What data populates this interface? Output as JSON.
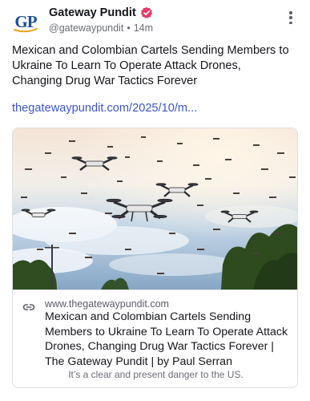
{
  "author": {
    "avatar_text": "GP",
    "name": "Gateway Pundit",
    "handle": "@gatewaypundit",
    "separator": "•",
    "time": "14m"
  },
  "post": {
    "text": "Mexican and Colombian Cartels Sending Members to Ukraine To Learn To Operate Attack Drones, Changing Drug War Tactics Forever",
    "link_text": "thegatewaypundit.com/2025/10/m..."
  },
  "card": {
    "domain": "www.thegatewaypundit.com",
    "title": "Mexican and Colombian Cartels Sending Members to Ukraine To Learn To Operate Attack Drones, Changing Drug War Tactics Forever | The Gateway Pundit | by Paul Serran",
    "description": "It’s a clear and present danger to the US."
  },
  "colors": {
    "link": "#3b55c9",
    "verified_badge": "#e8396b",
    "avatar_text": "#1d4f9c",
    "avatar_swoosh": "#e9a21f"
  },
  "icons": {
    "verified": "verified-badge-icon",
    "more": "more-vertical-icon",
    "card_link": "link-icon"
  }
}
